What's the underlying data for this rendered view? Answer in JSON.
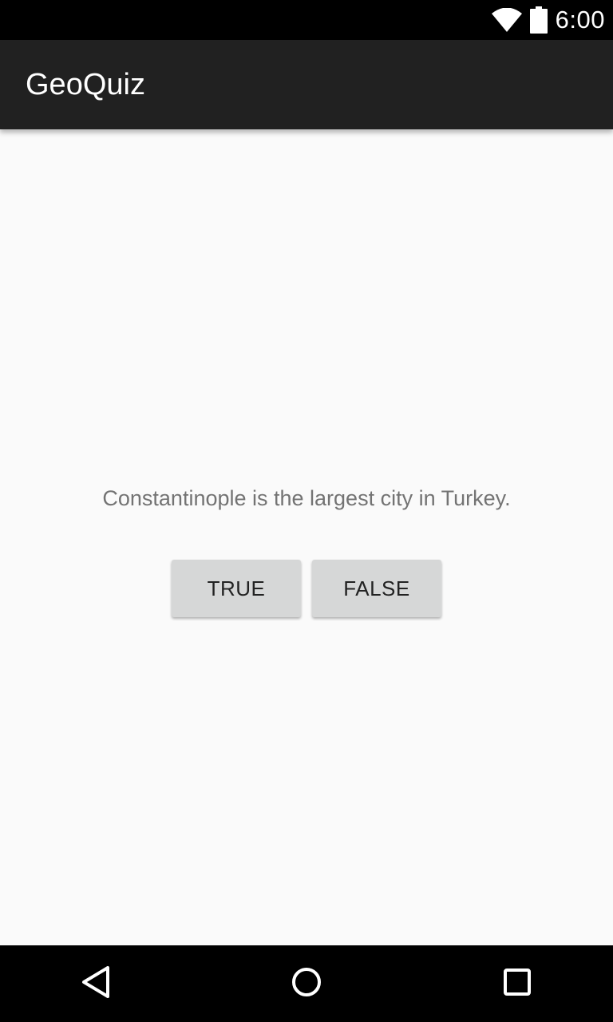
{
  "status_bar": {
    "time": "6:00",
    "icons": [
      "wifi-icon",
      "battery-icon"
    ]
  },
  "app_bar": {
    "title": "GeoQuiz"
  },
  "quiz": {
    "question": "Constantinople is the largest city in Turkey.",
    "true_label": "TRUE",
    "false_label": "FALSE"
  },
  "nav_bar": {
    "icons": [
      "back-icon",
      "home-icon",
      "recents-icon"
    ]
  },
  "colors": {
    "status_bar": "#000000",
    "app_bar": "#212121",
    "background": "#fafafa",
    "button": "#d6d7d7",
    "question_text": "#737373"
  }
}
